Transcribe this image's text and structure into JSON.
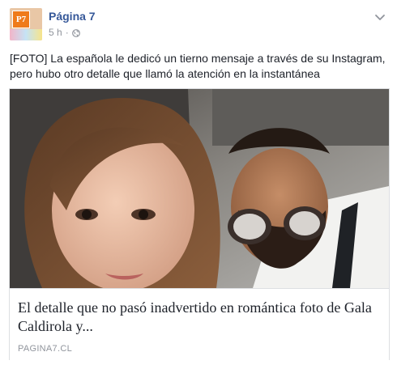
{
  "post": {
    "avatar_text": "P7",
    "page_name": "Página 7",
    "time": "5 h",
    "separator": "·",
    "privacy_icon": "globe-icon",
    "menu_icon": "chevron-down-icon",
    "message": "[FOTO] La española le dedicó un tierno mensaje a través de su Instagram, pero hubo otro detalle que llamó la atención en la instantánea"
  },
  "link_card": {
    "image_description": "selfie-photo",
    "title": "El detalle que no pasó inadvertido en romántica foto de Gala Caldirola y...",
    "domain": "PAGINA7.CL"
  },
  "colors": {
    "link_blue": "#365899",
    "meta_gray": "#90949c",
    "text_dark": "#1d2129",
    "border": "#dddfe2"
  }
}
